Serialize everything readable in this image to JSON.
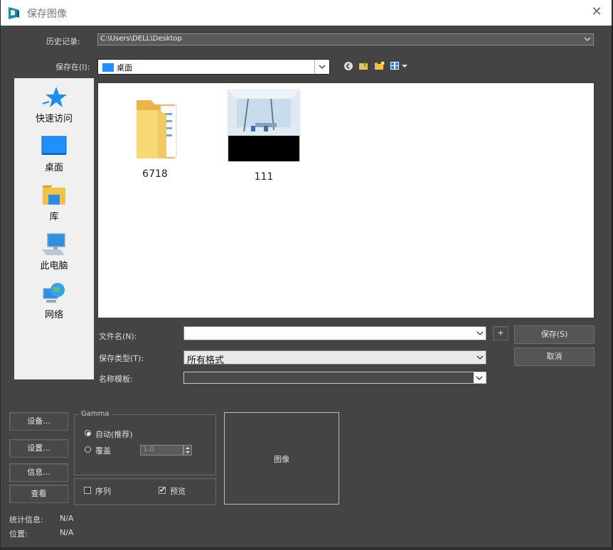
{
  "window": {
    "title": "保存图像",
    "close_glyph": "✕"
  },
  "history": {
    "label": "历史记录:",
    "value": "C:\\Users\\DELL\\Desktop"
  },
  "save_in": {
    "label": "保存在(I):",
    "value": "桌面"
  },
  "toolbar_icons": [
    "back-icon",
    "up-folder-icon",
    "new-folder-icon",
    "view-menu-icon"
  ],
  "places": [
    {
      "label": "快速访问",
      "icon": "star-icon"
    },
    {
      "label": "桌面",
      "icon": "desktop-icon"
    },
    {
      "label": "库",
      "icon": "library-icon"
    },
    {
      "label": "此电脑",
      "icon": "computer-icon"
    },
    {
      "label": "网络",
      "icon": "network-icon"
    }
  ],
  "files": [
    {
      "name": "6718",
      "type": "folder"
    },
    {
      "name": "111",
      "type": "image"
    }
  ],
  "filename": {
    "label": "文件名(N):",
    "value": "",
    "plus": "+"
  },
  "file_type": {
    "label": "保存类型(T):",
    "value": "所有格式"
  },
  "name_template": {
    "label": "名称模板:",
    "value": ""
  },
  "buttons": {
    "save": "保存(S)",
    "cancel": "取消"
  },
  "left_buttons": {
    "device": "设备...",
    "setup": "设置...",
    "info": "信息...",
    "view": "查看"
  },
  "gamma": {
    "legend": "Gamma",
    "auto_label": "自动(推荐)",
    "override_label": "覆盖",
    "override_value": "1.0",
    "selected": "auto"
  },
  "options": {
    "sequence_label": "序列",
    "sequence_checked": false,
    "preview_label": "预览",
    "preview_checked": true
  },
  "preview": {
    "label": "图像"
  },
  "stats": {
    "label": "统计信息:",
    "value": "N/A"
  },
  "location": {
    "label": "位置:",
    "value": "N/A"
  },
  "colors": {
    "dialog_bg": "#444444",
    "selection_blue": "#1e90ff"
  }
}
